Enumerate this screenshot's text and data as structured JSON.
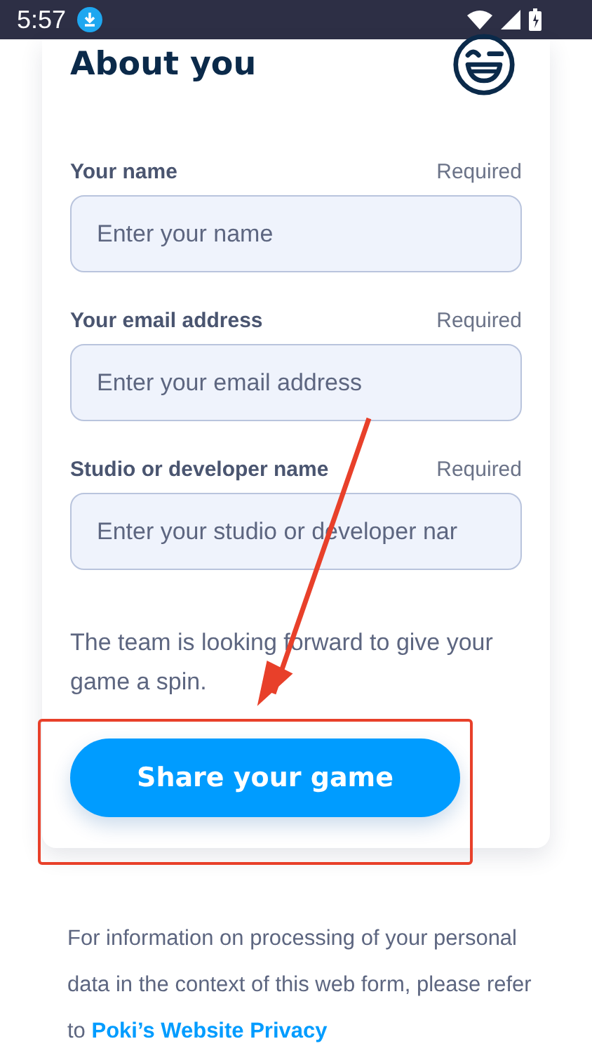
{
  "status_bar": {
    "time": "5:57"
  },
  "card": {
    "title": "About you",
    "fields": [
      {
        "label": "Your name",
        "requirement": "Required",
        "placeholder": "Enter your name"
      },
      {
        "label": "Your email address",
        "requirement": "Required",
        "placeholder": "Enter your email address"
      },
      {
        "label": "Studio or developer name",
        "requirement": "Required",
        "placeholder": "Enter your studio or developer nar"
      }
    ],
    "note": "The team is looking forward to give your game a spin.",
    "submit": "Share your game"
  },
  "footer": {
    "text": "For information on processing of your personal data in the context of this web form, please refer to",
    "link": "Poki’s Website Privacy"
  }
}
